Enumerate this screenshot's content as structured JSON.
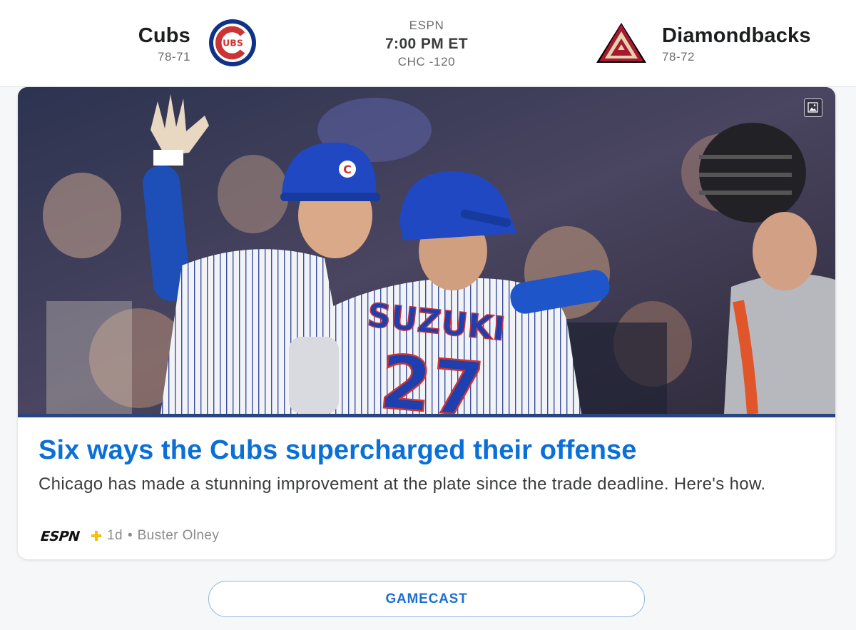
{
  "matchup": {
    "home": {
      "name": "Cubs",
      "record": "78-71",
      "logo_icon": "cubs-logo-icon",
      "logo_colors": [
        "#0e3386",
        "#cc3433",
        "#ffffff"
      ]
    },
    "away": {
      "name": "Diamondbacks",
      "record": "78-72",
      "logo_icon": "diamondbacks-logo-icon",
      "logo_colors": [
        "#a71930",
        "#e3d4ad",
        "#000000"
      ]
    },
    "network": "ESPN",
    "time": "7:00 PM ET",
    "odds": "CHC -120"
  },
  "story": {
    "image_icon": "image-icon",
    "image_jersey_name": "SUZUKI",
    "image_jersey_number": "27",
    "headline": "Six ways the Cubs supercharged their offense",
    "summary": "Chicago has made a stunning improvement at the plate since the trade deadline. Here's how.",
    "source_logo": "espn-plus-logo",
    "age": "1d",
    "author": "Buster Olney"
  },
  "actions": {
    "gamecast_label": "GAMECAST"
  },
  "colors": {
    "link_blue": "#0a6fd6",
    "button_border": "#8fb4e3",
    "cubs_blue": "#0e3386",
    "cubs_red": "#cc3433",
    "espn_plus_gold": "#f4c008"
  }
}
